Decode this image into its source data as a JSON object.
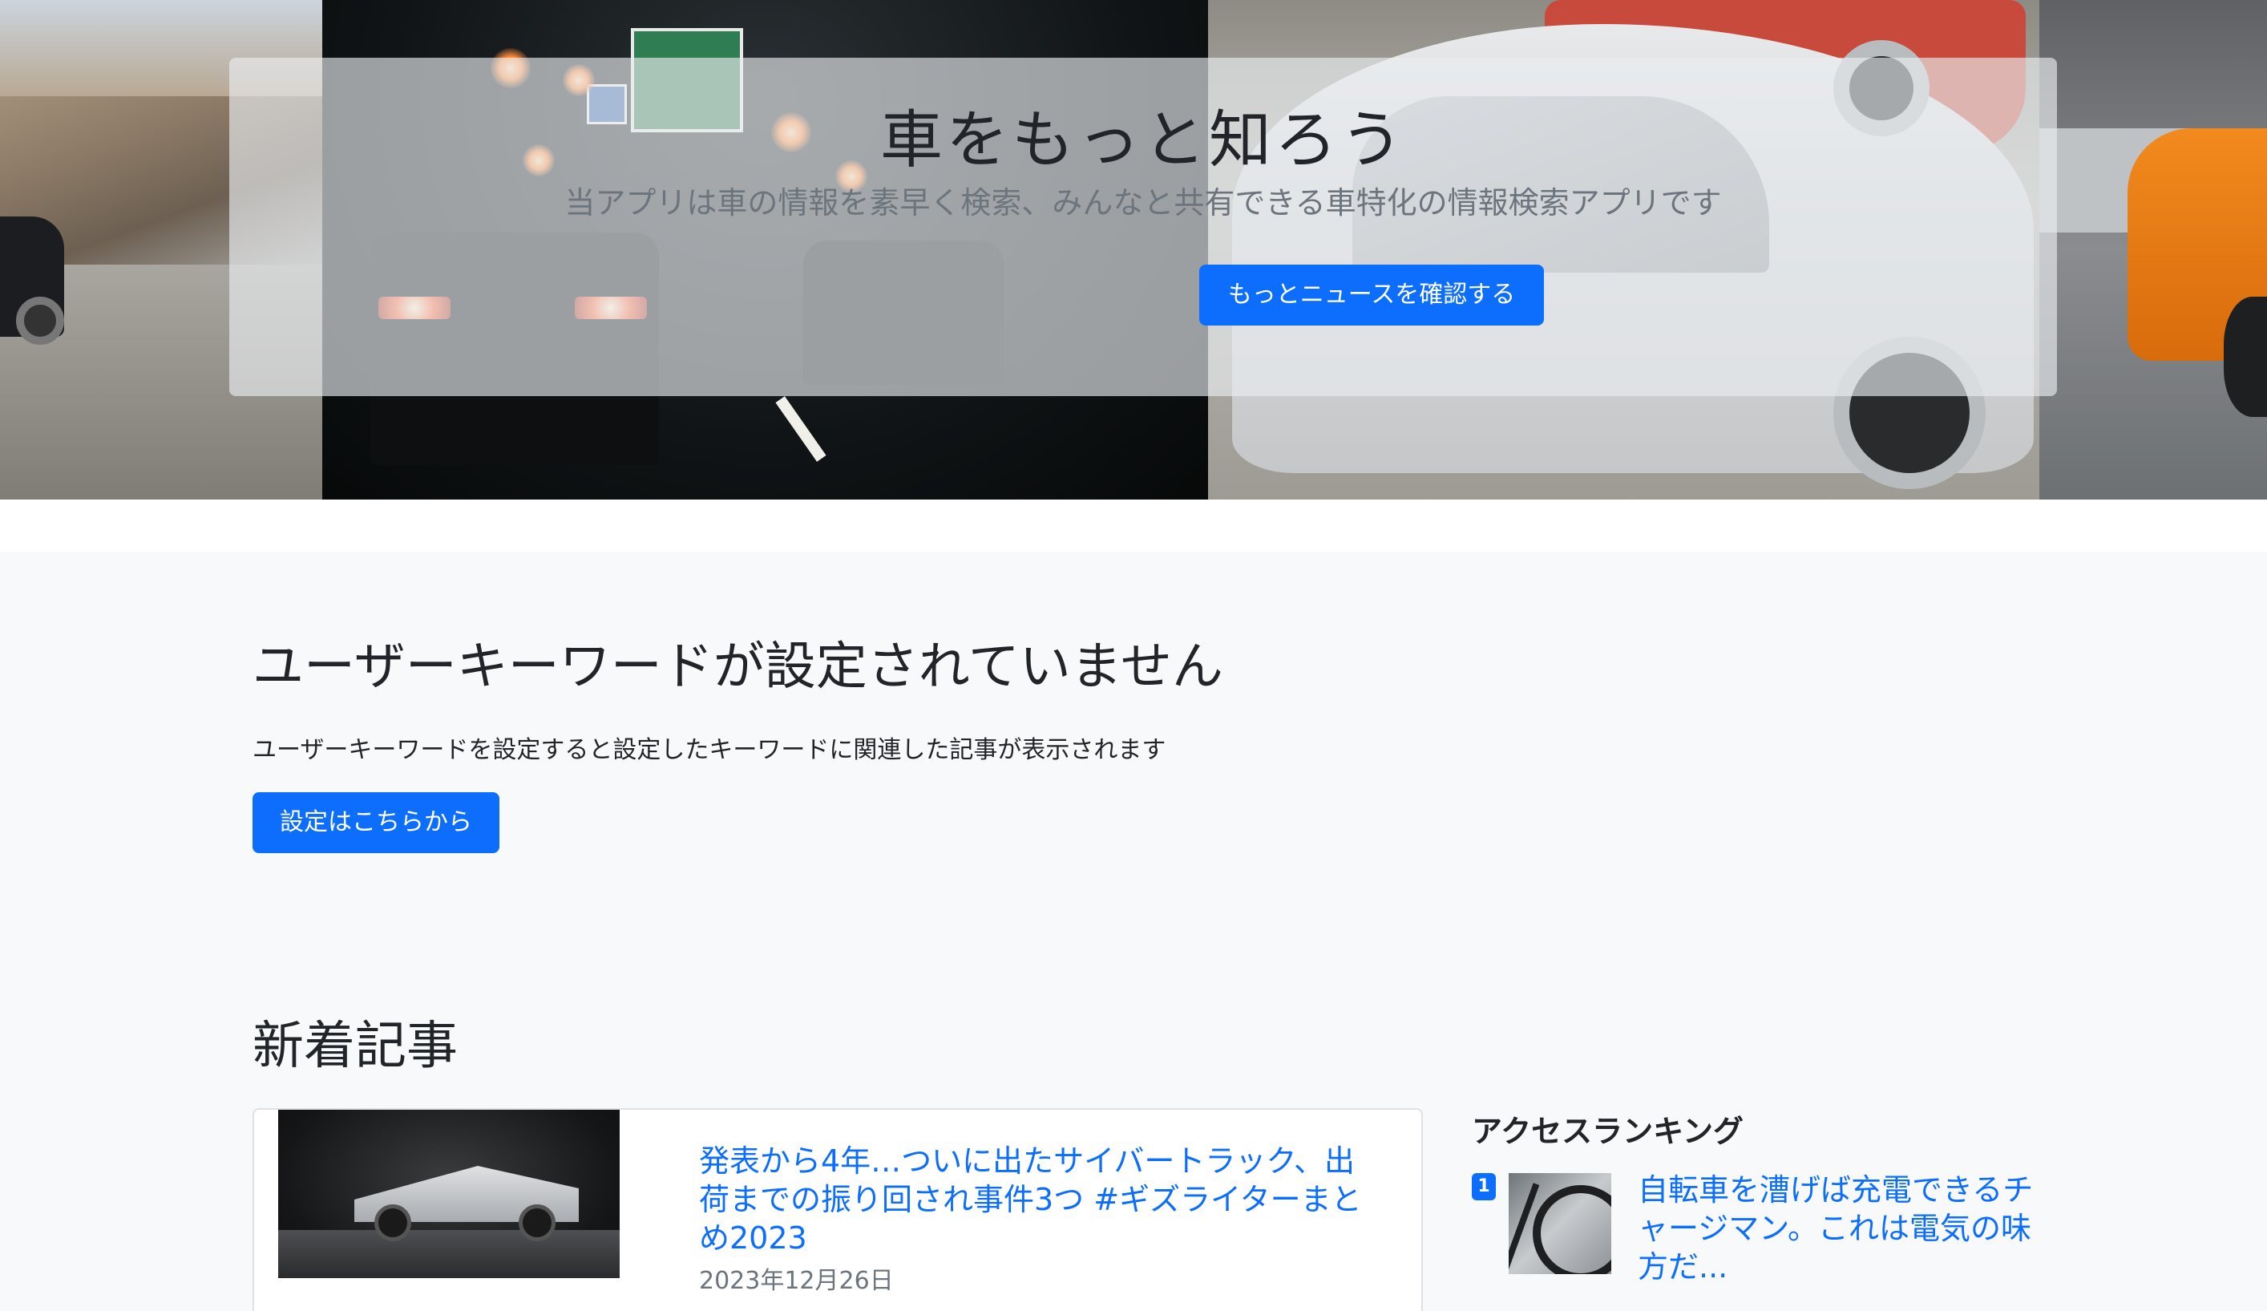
{
  "hero": {
    "title": "車をもっと知ろう",
    "lead": "当アプリは車の情報を素早く検索、みんなと共有できる車特化の情報検索アプリです",
    "button_label": "もっとニュースを確認する"
  },
  "keyword": {
    "heading": "ユーザーキーワードが設定されていません",
    "description": "ユーザーキーワードを設定すると設定したキーワードに関連した記事が表示されます",
    "button_label": "設定はこちらから"
  },
  "news": {
    "heading": "新着記事",
    "articles": [
      {
        "title": "発表から4年…ついに出たサイバートラック、出荷までの振り回され事件3つ #ギズライターまとめ2023",
        "date": "2023年12月26日"
      }
    ]
  },
  "ranking": {
    "heading": "アクセスランキング",
    "items": [
      {
        "rank": "1",
        "title": "自転車を漕げば充電できるチャージマン。これは電気の味方だ..."
      }
    ]
  },
  "colors": {
    "primary": "#0d6efd",
    "section_bg": "#f8f9fa",
    "muted_text": "#6c757d"
  }
}
